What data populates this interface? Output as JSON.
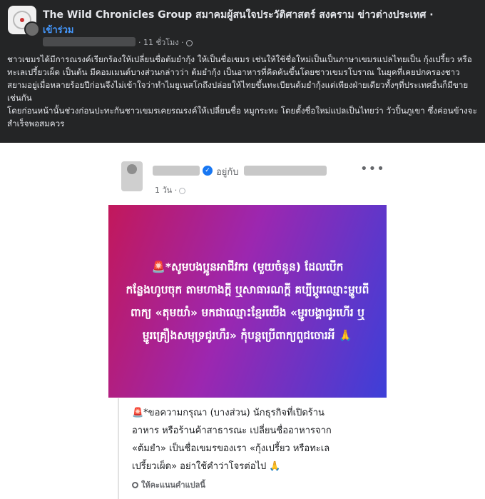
{
  "group_post": {
    "group_name": "The Wild Chronicles Group สมาคมผู้สนใจประวัติศาสตร์ สงคราม ข่าวต่างประเทศ ·",
    "join_label": "เข้าร่วม",
    "time_ago": "· 11 ชั่วโมง ·",
    "body_paragraphs": [
      "ชาวเขมรได้มีการณรงค์เรียกร้องให้เปลี่ยนชื่อต้มยำกุ้ง ให้เป็นชื่อเขมร เช่นให้ใช้ชื่อใหม่เป็นเป็นภาษาเขมรแปลไทยเป็น กุ้งเปรี้ยว หรือ ทะเลเปรี้ยวเผ็ด เป็นต้น มีคอมเมนต์บางส่วนกล่าวว่า ต้มยำกุ้ง เป็นอาหารที่คิดค้นขึ้นโดยชาวเขมรโบราณ ในยุคที่เคยปกครองชาวสยามอยู่เมื่อหลายร้อยปีก่อนจึงไม่เข้าใจว่าทำไมยูเนสโกถึงปล่อยให้ไทยขึ้นทะเบียนต้มยำกุ้งแต่เพียงฝ่ายเดียวทั้งๆที่ประเทศอื่นก็มีขายเช่นกัน",
      "โดยก่อนหน้านั้นช่วงก่อนปะทะกันชาวเขมรเคยรณรงค์ให้เปลี่ยนชื่อ หมูกระทะ โดยตั้งชื่อใหม่แปลเป็นไทยว่า วัวปิ้นภูเขา ซึ่งค่อนข้างจะสำเร็จพอสมควร"
    ]
  },
  "shared_post": {
    "with_label": "อยู่กับ",
    "time_ago": "1 วัน ·",
    "more_label": "•••",
    "verified_mark": "✓",
    "card_text": "🚨*សូមបងប្អូនអាជីវករ (មួយចំនួន) ដែលបើកកន្លែងហូបចុក តាមហាងក្តី ឬសាធារណក្តី គប្បីប្តូរឈ្មោះម្ហូបពីពាក្យ «តុមយាំ» មកជាឈ្មោះខ្មែរយើង «ម្ជូរបង្គាជូរហើរ ឬម្ជូរគ្រឿងសមុទ្រជូរហឹរ» កុំបន្តប្រើពាក្យពួជចោរអី 🙏",
    "card_gradient": [
      "#c2185b",
      "#9c27b0",
      "#3d3fd8"
    ],
    "translation_text": "🚨*ขอความกรุณา (บางส่วน) นักธุรกิจที่เปิดร้านอาหาร หรือร้านค้าสาธารณะ เปลี่ยนชื่ออาหารจาก «ต้มยำ» เป็นชื่อเขมรของเรา «กุ้งเปรี้ยว หรือทะเลเปรี้ยวเผ็ด» อย่าใช้คำว่าโจรต่อไป 🙏",
    "rate_translation_label": "ให้คะแนนคำแปลนี้"
  },
  "colors": {
    "dark_background": "#242526",
    "link_blue": "#4599ff",
    "verified_blue": "#1877f2"
  }
}
